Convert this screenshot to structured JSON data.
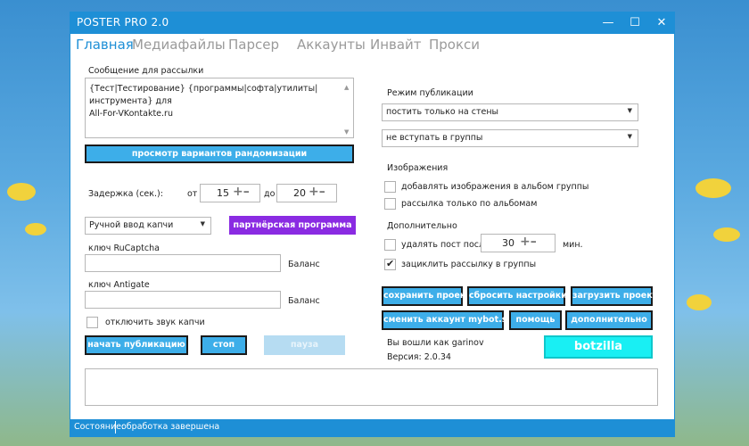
{
  "window": {
    "title": "POSTER PRO 2.0"
  },
  "tabs": [
    {
      "label": "Главная"
    },
    {
      "label": "Медиафайлы"
    },
    {
      "label": "Парсер"
    },
    {
      "label": "Аккаунты"
    },
    {
      "label": "Инвайт"
    },
    {
      "label": "Прокси"
    }
  ],
  "message": {
    "label": "Сообщение для рассылки",
    "text": "{Тест|Тестирование} {программы|софта|утилиты|инструмента} для\nAll-For-VKontakte.ru"
  },
  "preview_button": "просмотр вариантов рандомизации",
  "delay": {
    "label": "Задержка  (сек.):",
    "from_label": "от",
    "from_value": "15",
    "to_label": "до",
    "to_value": "20"
  },
  "captcha": {
    "mode_selected": "Ручной ввод капчи",
    "partner_button": "партнёрская программа"
  },
  "rucaptcha": {
    "label": "ключ RuCaptcha",
    "value": "",
    "balance_label": "Баланс"
  },
  "antigate": {
    "label": "ключ Antigate",
    "value": "",
    "balance_label": "Баланс"
  },
  "mute_captcha": {
    "label": "отключить звук капчи",
    "checked": false
  },
  "actions": {
    "start": "начать публикацию",
    "stop": "стоп",
    "pause": "пауза"
  },
  "publish_mode": {
    "label": "Режим публикации",
    "select1": "постить только на стены",
    "select2": "не вступать в группы"
  },
  "images": {
    "label": "Изображения",
    "add_to_album": {
      "label": "добавлять изображения в альбом группы",
      "checked": false
    },
    "albums_only": {
      "label": "рассылка только по альбомам",
      "checked": false
    }
  },
  "extra": {
    "label": "Дополнительно",
    "delete_post": {
      "label": "удалять пост после",
      "checked": false,
      "value": "30",
      "unit": "мин."
    },
    "loop": {
      "label": "зациклить рассылку в группы",
      "checked": true
    }
  },
  "project_buttons": {
    "save": "сохранить проект",
    "reset": "сбросить настройки",
    "load": "загрузить проект",
    "change_account": "сменить аккаунт mybot.su",
    "help": "помощь",
    "more": "дополнительно"
  },
  "login": {
    "text": "Вы вошли как garinov",
    "version": "Версия: 2.0.34"
  },
  "botzilla": "botzilla",
  "status": {
    "label": "Состояние:",
    "value": "обработка завершена"
  },
  "colors": {
    "accent": "#1e8fd6",
    "button": "#3daee9",
    "purple": "#8a2be2",
    "cyan": "#19eff3"
  },
  "icons": {
    "minimize": "minimize-icon",
    "maximize": "maximize-icon",
    "close": "close-icon"
  }
}
